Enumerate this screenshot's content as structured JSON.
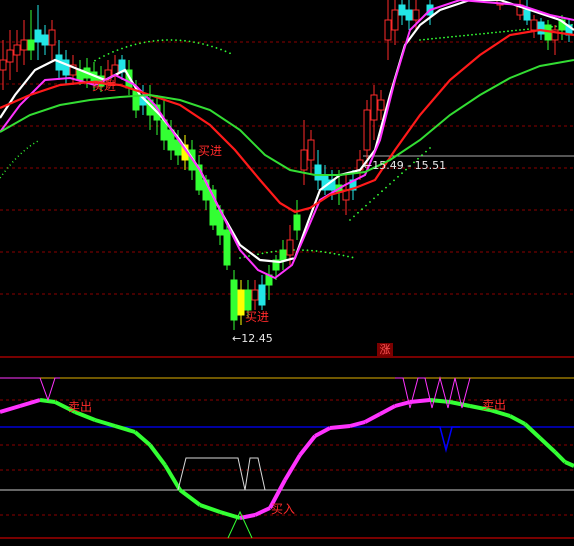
{
  "colors": {
    "background": "#000000",
    "bull_candle": "#ff2a2a",
    "bear_candle": "#33ff33",
    "cyan_candle": "#22e6e6",
    "yellow_candle": "#ffff00",
    "ma_white": "#ffffff",
    "ma_magenta": "#ff33ff",
    "ma_red": "#ff1a1a",
    "ma_green": "#33dd33",
    "grid": "#8b0000",
    "divider": "#a00000",
    "osc_blue": "#0000ff",
    "osc_gold": "#e0b000",
    "osc_white": "#d8d8d8"
  },
  "main_panel": {
    "signals": {
      "buy_in_upper": "买进",
      "buy_in_lower": "买进",
      "buy_in_small": "买进"
    },
    "price_low": "12.45",
    "price_range": "15.49 - 15.51",
    "rise_badge": "涨"
  },
  "indicator_panel": {
    "sell_left": "卖出",
    "sell_right": "卖出",
    "buy": "买入"
  }
}
